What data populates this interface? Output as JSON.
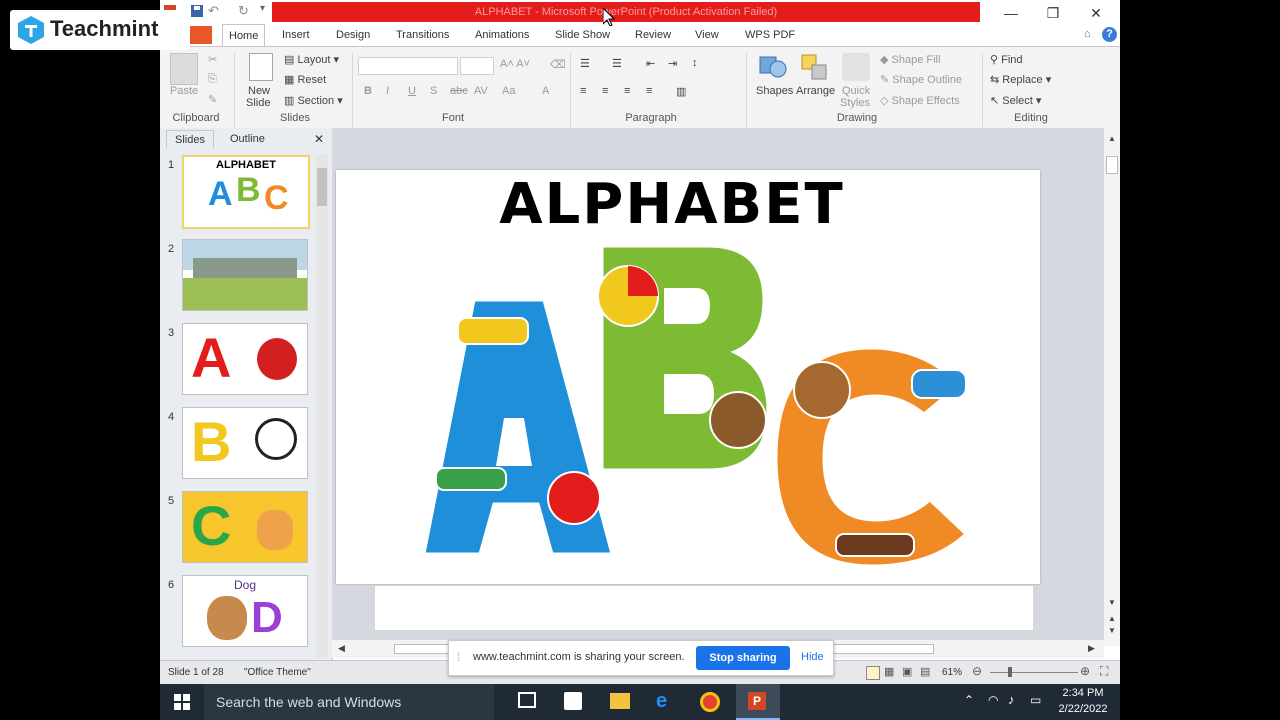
{
  "brand": {
    "name": "Teachmint"
  },
  "window": {
    "title": "ALPHABET - Microsoft PowerPoint (Product Activation Failed)",
    "controls": {
      "minimize": "—",
      "restore": "❐",
      "close": "✕"
    }
  },
  "tabs": [
    "Home",
    "Insert",
    "Design",
    "Transitions",
    "Animations",
    "Slide Show",
    "Review",
    "View",
    "WPS PDF"
  ],
  "ribbon": {
    "clipboard": {
      "paste": "Paste",
      "label": "Clipboard"
    },
    "slides": {
      "new_slide_line1": "New",
      "new_slide_line2": "Slide",
      "layout": "Layout",
      "reset": "Reset",
      "section": "Section",
      "label": "Slides"
    },
    "font": {
      "bold": "B",
      "italic": "I",
      "underline": "U",
      "strike": "S",
      "label": "Font"
    },
    "paragraph": {
      "label": "Paragraph"
    },
    "drawing": {
      "shapes": "Shapes",
      "arrange": "Arrange",
      "quick_styles_line1": "Quick",
      "quick_styles_line2": "Styles",
      "shape_fill": "Shape Fill",
      "shape_outline": "Shape Outline",
      "shape_effects": "Shape Effects",
      "label": "Drawing"
    },
    "editing": {
      "find": "Find",
      "replace": "Replace",
      "select": "Select",
      "label": "Editing"
    }
  },
  "panel": {
    "tabs": [
      "Slides",
      "Outline"
    ],
    "close": "✕",
    "slides": [
      {
        "num": "1",
        "text": "ALPHABET"
      },
      {
        "num": "2",
        "text": ""
      },
      {
        "num": "3",
        "text": "A"
      },
      {
        "num": "4",
        "text": "B"
      },
      {
        "num": "5",
        "text": "C"
      },
      {
        "num": "6",
        "text": "Dog"
      }
    ]
  },
  "slide": {
    "title": "ALPHABET",
    "letters": [
      "A",
      "B",
      "C"
    ]
  },
  "share_bar": {
    "message": "www.teachmint.com is sharing your screen.",
    "stop": "Stop sharing",
    "hide": "Hide"
  },
  "status": {
    "slide_info": "Slide 1 of 28",
    "theme": "\"Office Theme\"",
    "zoom": "61%"
  },
  "taskbar": {
    "search": "Search the web and Windows",
    "time": "2:34 PM",
    "date": "2/22/2022"
  },
  "colors": {
    "title_red": "#e31c1c",
    "letter_a": "#1e8fd8",
    "letter_b": "#7dbb34",
    "letter_c": "#f08a24",
    "share_blue": "#1a73e8"
  }
}
